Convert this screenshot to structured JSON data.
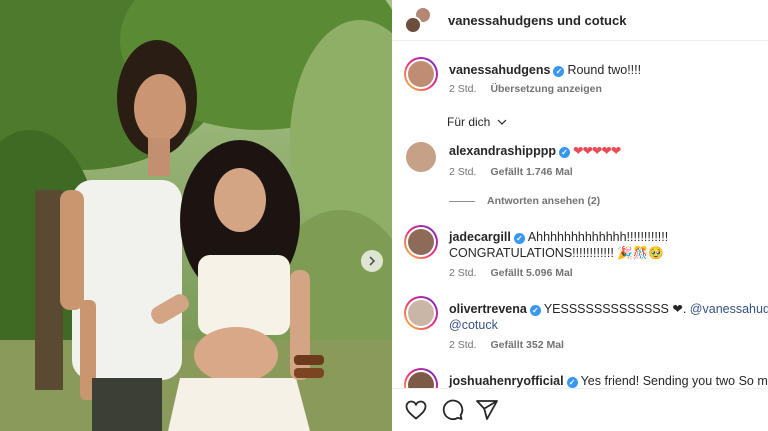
{
  "header": {
    "title": "vanessahudgens und cotuck"
  },
  "caption": {
    "username": "vanessahudgens",
    "text": "Round two!!!!",
    "time": "2 Std.",
    "translate": "Übersetzung anzeigen"
  },
  "for_you": "Für dich",
  "comments": [
    {
      "username": "alexandraship​ppp",
      "text": "❤❤❤❤❤",
      "time": "2 Std.",
      "likes": "Gefällt 1.746 Mal"
    },
    {
      "username": "jadecargill",
      "text": "Ahhhhhhhhhhhhh!!!!!!!!!!!!",
      "text2": "CONGRATULATIONS!!!!!!!!!!!! 🎉🎊🥹",
      "time": "2 Std.",
      "likes": "Gefällt 5.096 Mal"
    },
    {
      "username": "olivertrevena",
      "text": "YESSSSSSSSSSSSS ❤.",
      "mention1": "@vanessahudge",
      "mention2": "@cotuck",
      "time": "2 Std.",
      "likes": "Gefällt 352 Mal"
    },
    {
      "username": "joshuahenryofficial",
      "text": "Yes friend! Sending you two So mu"
    }
  ],
  "view_replies": "Antworten ansehen (2)",
  "icons": [
    "heart-icon",
    "comment-icon",
    "share-icon",
    "chevron-right-icon",
    "chevron-down-icon",
    "verified-badge-icon"
  ],
  "colors": {
    "verified": "#3897f0",
    "heart": "#ed4956",
    "mention": "#385185",
    "meta": "#737373"
  }
}
